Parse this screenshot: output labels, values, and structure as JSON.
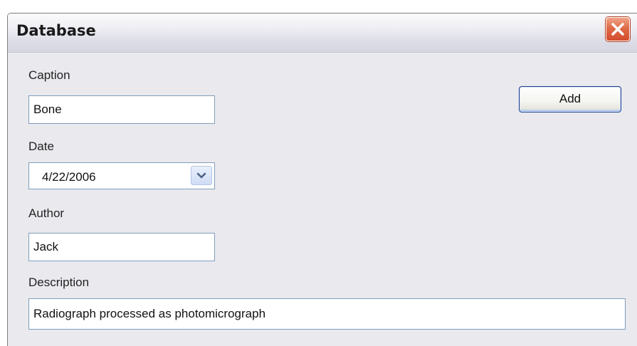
{
  "window": {
    "title": "Database"
  },
  "form": {
    "caption": {
      "label": "Caption",
      "value": "Bone"
    },
    "date": {
      "label": "Date",
      "value": "4/22/2006"
    },
    "author": {
      "label": "Author",
      "value": "Jack"
    },
    "description": {
      "label": "Description",
      "value": "Radiograph processed as photomicrograph"
    }
  },
  "buttons": {
    "add_label": "Add"
  },
  "icons": {
    "close": "close-icon",
    "dropdown": "chevron-down-icon"
  },
  "colors": {
    "window_bg": "#eae9ee",
    "close_button": "#d24d2c",
    "input_border": "#7f9db9",
    "default_button_border": "#1c3f8c"
  }
}
